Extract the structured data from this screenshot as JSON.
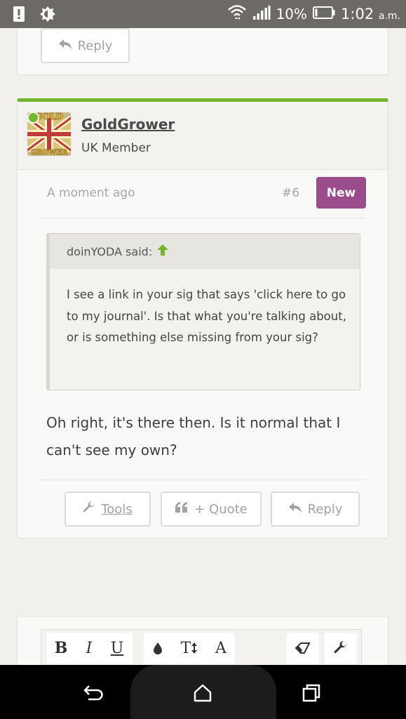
{
  "status_bar": {
    "battery_percent": "10%",
    "time": "1:02",
    "ampm": "a.m.",
    "icons": [
      "alert-icon",
      "brightness-icon",
      "wifi-icon",
      "signal-icon",
      "battery-icon"
    ]
  },
  "prev_post": {
    "reply_label": "Reply"
  },
  "post": {
    "username": "GoldGrower",
    "user_title": "UK Member",
    "timestamp": "A moment ago",
    "post_number": "#6",
    "new_badge": "New",
    "quote": {
      "author_line": "doinYODA said:",
      "text": "I see a link in your sig that says 'click here to go to my journal'. Is that what you're talking about, or is something else missing from your sig?"
    },
    "message": "Oh right, it's there then. Is it normal that I can't see my own?",
    "actions": {
      "tools_label": "Tools",
      "quote_label": "+ Quote",
      "reply_label": "Reply"
    }
  },
  "editor": {
    "bold": "B",
    "italic": "I",
    "underline": "U",
    "font_size": "T",
    "font_color": "A"
  },
  "colors": {
    "accent_green": "#73b52c",
    "new_badge": "#9b4c8c"
  }
}
